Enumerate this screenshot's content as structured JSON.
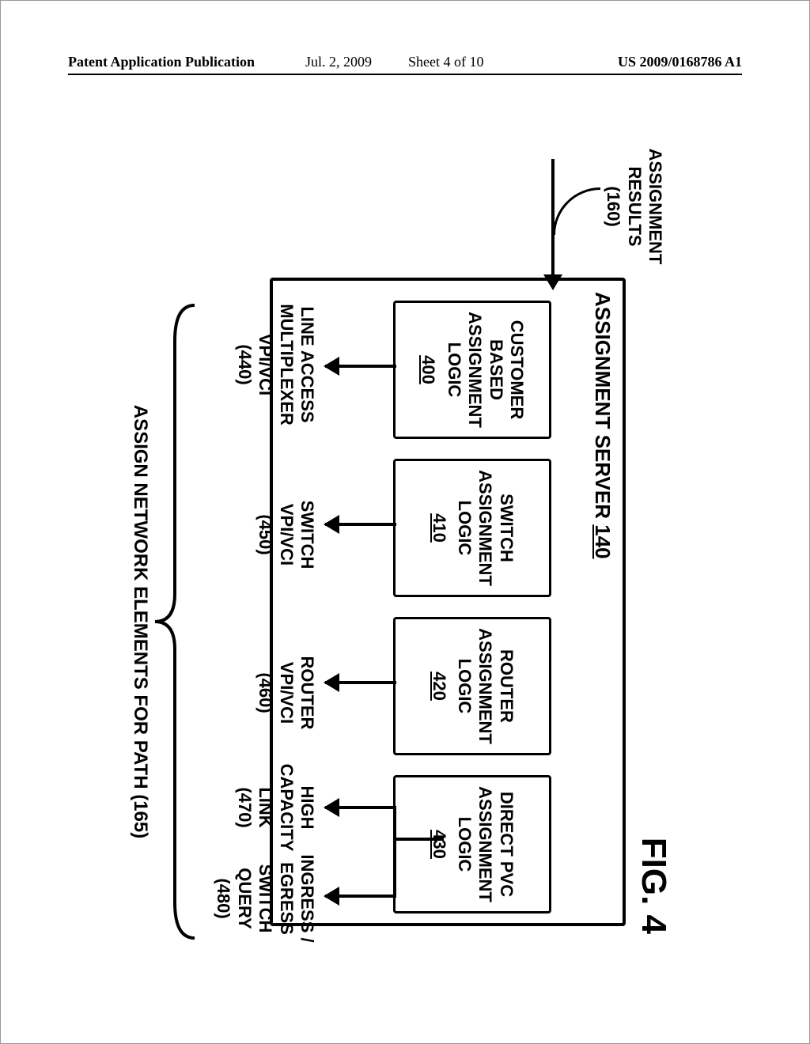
{
  "header": {
    "left": "Patent Application Publication",
    "date": "Jul. 2, 2009",
    "sheet": "Sheet 4 of 10",
    "pubno": "US 2009/0168786 A1"
  },
  "figure_title": "FIG. 4",
  "input": {
    "label_l1": "ASSIGNMENT",
    "label_l2": "RESULTS",
    "label_l3": "(160)"
  },
  "server": {
    "title_text": "ASSIGNMENT SERVER",
    "title_ref": "140"
  },
  "logic": [
    {
      "l1": "CUSTOMER",
      "l2": "BASED",
      "l3": "ASSIGNMENT",
      "l4": "LOGIC",
      "ref": "400"
    },
    {
      "l1": "SWITCH",
      "l2": "ASSIGNMENT",
      "l3": "LOGIC",
      "l4": "",
      "ref": "410"
    },
    {
      "l1": "ROUTER",
      "l2": "ASSIGNMENT",
      "l3": "LOGIC",
      "l4": "",
      "ref": "420"
    },
    {
      "l1": "DIRECT PVC",
      "l2": "ASSIGNMENT",
      "l3": "LOGIC",
      "l4": "",
      "ref": "430"
    }
  ],
  "outputs": [
    {
      "l1": "LINE ACCESS",
      "l2": "MULTIPLEXER",
      "l3": "VPI/VCI",
      "l4": "(440)"
    },
    {
      "l1": "SWITCH",
      "l2": "VPI/VCI",
      "l3": "(450)",
      "l4": ""
    },
    {
      "l1": "ROUTER",
      "l2": "VPI/VCI",
      "l3": "(460)",
      "l4": ""
    },
    {
      "l1": "HIGH",
      "l2": "CAPACITY",
      "l3": "LINK",
      "l4": "(470)"
    },
    {
      "l1": "INGRESS /",
      "l2": "EGRESS",
      "l3": "SWITCH",
      "l4": "QUERY",
      "l5": "(480)"
    }
  ],
  "caption": "ASSIGN NETWORK ELEMENTS FOR PATH (165)"
}
